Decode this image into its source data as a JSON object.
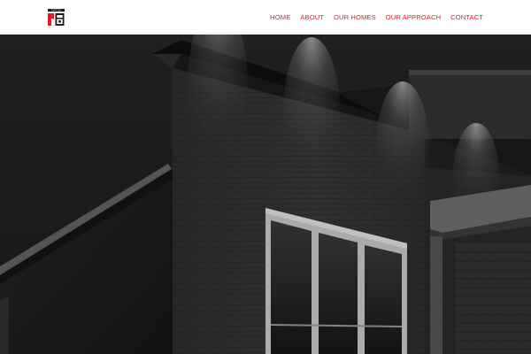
{
  "brand": {
    "logo_text": "TATTOO",
    "logo_icon": "brand-logo-icon",
    "accent_color": "#d81f26"
  },
  "nav": {
    "items": [
      {
        "label": "HOME"
      },
      {
        "label": "ABOUT"
      },
      {
        "label": "OUR HOMES"
      },
      {
        "label": "OUR APPROACH"
      },
      {
        "label": "CONTACT"
      }
    ]
  },
  "hero": {
    "image": "house-exterior-night-photo"
  }
}
